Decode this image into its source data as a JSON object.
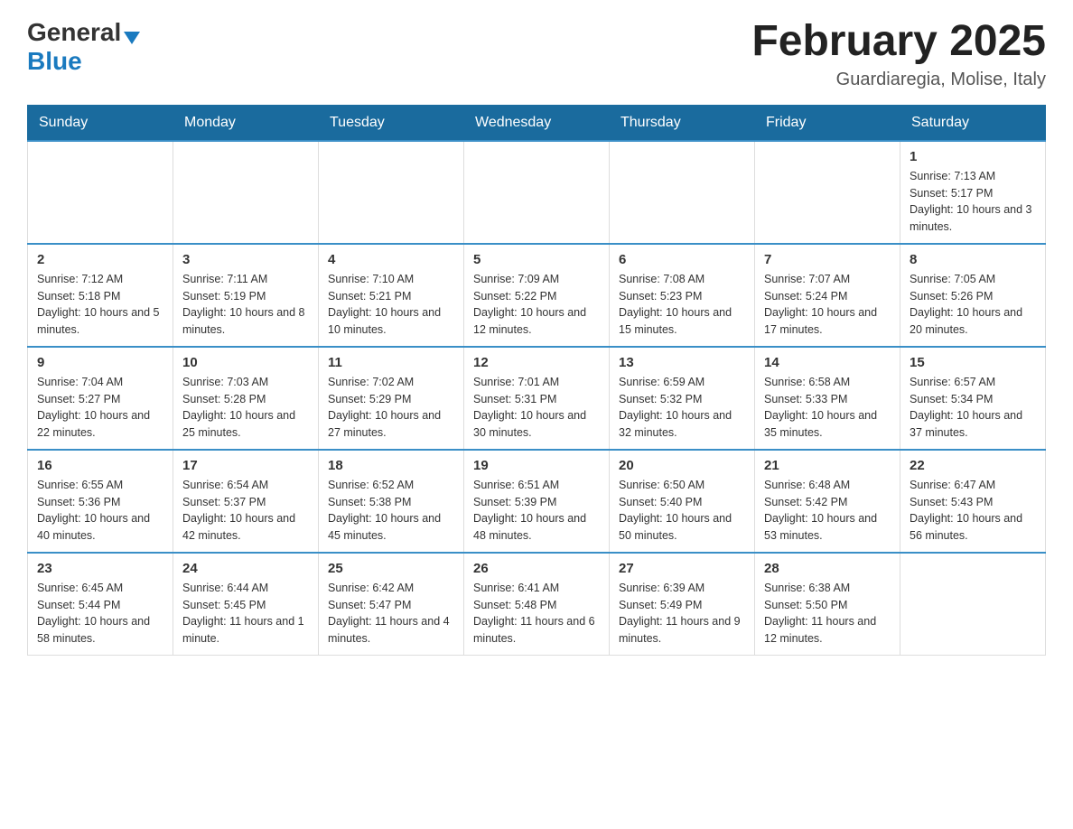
{
  "header": {
    "logo_general": "General",
    "logo_blue": "Blue",
    "month_title": "February 2025",
    "location": "Guardiaregia, Molise, Italy"
  },
  "days_of_week": [
    "Sunday",
    "Monday",
    "Tuesday",
    "Wednesday",
    "Thursday",
    "Friday",
    "Saturday"
  ],
  "weeks": [
    [
      {
        "day": "",
        "sunrise": "",
        "sunset": "",
        "daylight": ""
      },
      {
        "day": "",
        "sunrise": "",
        "sunset": "",
        "daylight": ""
      },
      {
        "day": "",
        "sunrise": "",
        "sunset": "",
        "daylight": ""
      },
      {
        "day": "",
        "sunrise": "",
        "sunset": "",
        "daylight": ""
      },
      {
        "day": "",
        "sunrise": "",
        "sunset": "",
        "daylight": ""
      },
      {
        "day": "",
        "sunrise": "",
        "sunset": "",
        "daylight": ""
      },
      {
        "day": "1",
        "sunrise": "Sunrise: 7:13 AM",
        "sunset": "Sunset: 5:17 PM",
        "daylight": "Daylight: 10 hours and 3 minutes."
      }
    ],
    [
      {
        "day": "2",
        "sunrise": "Sunrise: 7:12 AM",
        "sunset": "Sunset: 5:18 PM",
        "daylight": "Daylight: 10 hours and 5 minutes."
      },
      {
        "day": "3",
        "sunrise": "Sunrise: 7:11 AM",
        "sunset": "Sunset: 5:19 PM",
        "daylight": "Daylight: 10 hours and 8 minutes."
      },
      {
        "day": "4",
        "sunrise": "Sunrise: 7:10 AM",
        "sunset": "Sunset: 5:21 PM",
        "daylight": "Daylight: 10 hours and 10 minutes."
      },
      {
        "day": "5",
        "sunrise": "Sunrise: 7:09 AM",
        "sunset": "Sunset: 5:22 PM",
        "daylight": "Daylight: 10 hours and 12 minutes."
      },
      {
        "day": "6",
        "sunrise": "Sunrise: 7:08 AM",
        "sunset": "Sunset: 5:23 PM",
        "daylight": "Daylight: 10 hours and 15 minutes."
      },
      {
        "day": "7",
        "sunrise": "Sunrise: 7:07 AM",
        "sunset": "Sunset: 5:24 PM",
        "daylight": "Daylight: 10 hours and 17 minutes."
      },
      {
        "day": "8",
        "sunrise": "Sunrise: 7:05 AM",
        "sunset": "Sunset: 5:26 PM",
        "daylight": "Daylight: 10 hours and 20 minutes."
      }
    ],
    [
      {
        "day": "9",
        "sunrise": "Sunrise: 7:04 AM",
        "sunset": "Sunset: 5:27 PM",
        "daylight": "Daylight: 10 hours and 22 minutes."
      },
      {
        "day": "10",
        "sunrise": "Sunrise: 7:03 AM",
        "sunset": "Sunset: 5:28 PM",
        "daylight": "Daylight: 10 hours and 25 minutes."
      },
      {
        "day": "11",
        "sunrise": "Sunrise: 7:02 AM",
        "sunset": "Sunset: 5:29 PM",
        "daylight": "Daylight: 10 hours and 27 minutes."
      },
      {
        "day": "12",
        "sunrise": "Sunrise: 7:01 AM",
        "sunset": "Sunset: 5:31 PM",
        "daylight": "Daylight: 10 hours and 30 minutes."
      },
      {
        "day": "13",
        "sunrise": "Sunrise: 6:59 AM",
        "sunset": "Sunset: 5:32 PM",
        "daylight": "Daylight: 10 hours and 32 minutes."
      },
      {
        "day": "14",
        "sunrise": "Sunrise: 6:58 AM",
        "sunset": "Sunset: 5:33 PM",
        "daylight": "Daylight: 10 hours and 35 minutes."
      },
      {
        "day": "15",
        "sunrise": "Sunrise: 6:57 AM",
        "sunset": "Sunset: 5:34 PM",
        "daylight": "Daylight: 10 hours and 37 minutes."
      }
    ],
    [
      {
        "day": "16",
        "sunrise": "Sunrise: 6:55 AM",
        "sunset": "Sunset: 5:36 PM",
        "daylight": "Daylight: 10 hours and 40 minutes."
      },
      {
        "day": "17",
        "sunrise": "Sunrise: 6:54 AM",
        "sunset": "Sunset: 5:37 PM",
        "daylight": "Daylight: 10 hours and 42 minutes."
      },
      {
        "day": "18",
        "sunrise": "Sunrise: 6:52 AM",
        "sunset": "Sunset: 5:38 PM",
        "daylight": "Daylight: 10 hours and 45 minutes."
      },
      {
        "day": "19",
        "sunrise": "Sunrise: 6:51 AM",
        "sunset": "Sunset: 5:39 PM",
        "daylight": "Daylight: 10 hours and 48 minutes."
      },
      {
        "day": "20",
        "sunrise": "Sunrise: 6:50 AM",
        "sunset": "Sunset: 5:40 PM",
        "daylight": "Daylight: 10 hours and 50 minutes."
      },
      {
        "day": "21",
        "sunrise": "Sunrise: 6:48 AM",
        "sunset": "Sunset: 5:42 PM",
        "daylight": "Daylight: 10 hours and 53 minutes."
      },
      {
        "day": "22",
        "sunrise": "Sunrise: 6:47 AM",
        "sunset": "Sunset: 5:43 PM",
        "daylight": "Daylight: 10 hours and 56 minutes."
      }
    ],
    [
      {
        "day": "23",
        "sunrise": "Sunrise: 6:45 AM",
        "sunset": "Sunset: 5:44 PM",
        "daylight": "Daylight: 10 hours and 58 minutes."
      },
      {
        "day": "24",
        "sunrise": "Sunrise: 6:44 AM",
        "sunset": "Sunset: 5:45 PM",
        "daylight": "Daylight: 11 hours and 1 minute."
      },
      {
        "day": "25",
        "sunrise": "Sunrise: 6:42 AM",
        "sunset": "Sunset: 5:47 PM",
        "daylight": "Daylight: 11 hours and 4 minutes."
      },
      {
        "day": "26",
        "sunrise": "Sunrise: 6:41 AM",
        "sunset": "Sunset: 5:48 PM",
        "daylight": "Daylight: 11 hours and 6 minutes."
      },
      {
        "day": "27",
        "sunrise": "Sunrise: 6:39 AM",
        "sunset": "Sunset: 5:49 PM",
        "daylight": "Daylight: 11 hours and 9 minutes."
      },
      {
        "day": "28",
        "sunrise": "Sunrise: 6:38 AM",
        "sunset": "Sunset: 5:50 PM",
        "daylight": "Daylight: 11 hours and 12 minutes."
      },
      {
        "day": "",
        "sunrise": "",
        "sunset": "",
        "daylight": ""
      }
    ]
  ]
}
